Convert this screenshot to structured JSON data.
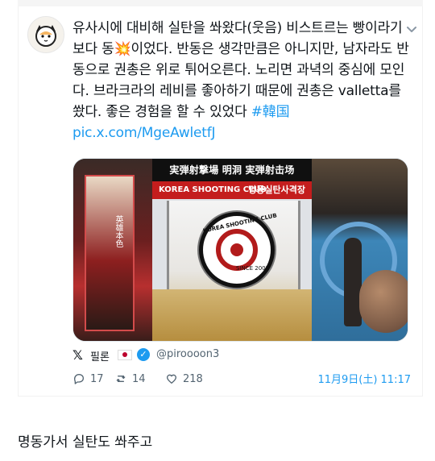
{
  "tweet": {
    "text_parts": [
      {
        "type": "text",
        "value": "유사시에 대비해 실탄을 쏴왔다(웃음) 비스트르는 빵이라기보다 동"
      },
      {
        "type": "emoji",
        "value": "💥"
      },
      {
        "type": "text",
        "value": "이었다. 반동은 생각만큼은 아니지만, 남자라도 반동으로 권총은 위로 튀어오른다. 노리면 과녁의 중심에 모인다. 브라크라의 레비를 좋아하기 때문에 권총은 valletta를 쐈다. 좋은 경험을 할 수 있었다 "
      },
      {
        "type": "hashtag",
        "value": "#韓国"
      },
      {
        "type": "text",
        "value": " "
      },
      {
        "type": "link",
        "value": "pic.x.com/MgeAwletfJ"
      }
    ],
    "media": {
      "sign_top": "実弾射撃場 明洞 実弾射击场",
      "sign_en": "KOREA SHOOTING CLUB",
      "sign_ko": "명동실탄사격장",
      "emblem": "KOREA SHOOTING CLUB",
      "since": "SINCE 2005"
    },
    "author": {
      "name": "필론",
      "handle": "@piroooon3",
      "verified": true,
      "flag": "JP"
    },
    "stats": {
      "replies": "17",
      "retweets": "14",
      "likes": "218",
      "date": "11月9日(土) 11:17"
    }
  },
  "caption": "명동가서 실탄도 쏴주고",
  "colors": {
    "link": "#1d9bf0",
    "text": "#0f1419",
    "muted": "#536471"
  },
  "icons": [
    "avatar-cat",
    "chevron-down-icon",
    "x-logo-icon",
    "verified-badge-icon",
    "reply-icon",
    "retweet-icon",
    "like-icon"
  ]
}
